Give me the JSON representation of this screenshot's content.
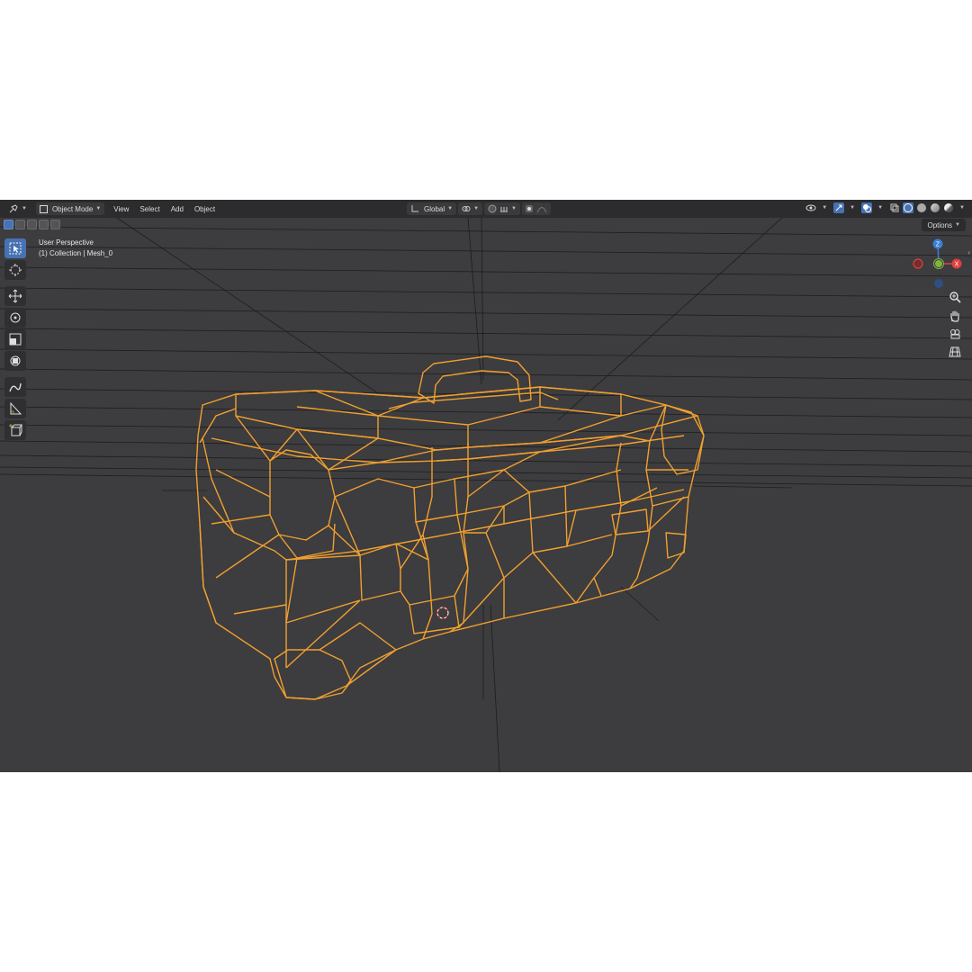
{
  "header": {
    "mode_label": "Object Mode",
    "menus": [
      "View",
      "Select",
      "Add",
      "Object"
    ],
    "orientation_label": "Global",
    "options_label": "Options"
  },
  "viewport": {
    "perspective_label": "User Perspective",
    "collection_label": "(1) Collection | Mesh_0"
  },
  "gizmo": {
    "z_label": "Z",
    "x_label": "X",
    "y_label": "Y"
  },
  "icons": {
    "editor_type": "editor-type-icon",
    "object_mode": "object-mode-icon",
    "transform_orientation": "axis-icon",
    "pivot": "pivot-icon",
    "snap": "magnet-icon",
    "proportional": "proportional-edit-icon",
    "tools": [
      "select-box-icon",
      "cursor-icon",
      "move-icon",
      "rotate-icon",
      "scale-icon",
      "transform-icon",
      "annotate-icon",
      "measure-icon",
      "add-cube-icon"
    ],
    "nav": [
      "zoom-icon",
      "hand-icon",
      "camera-icon",
      "grid-icon"
    ],
    "visibility": "eye-icon",
    "gizmo": "gizmo-icon",
    "overlays": "overlays-icon",
    "xray": "xray-icon",
    "shading": [
      "wireframe-shading-icon",
      "solid-shading-icon",
      "material-shading-icon",
      "rendered-shading-icon"
    ]
  },
  "colors": {
    "background": "#3d3c3e",
    "header": "#2c2b2d",
    "wireframe_selected": "#f0a030",
    "active_tool": "#4772b3",
    "axis_x": "#e0413f",
    "axis_y": "#7fb43d",
    "axis_z": "#3a7fd6"
  }
}
